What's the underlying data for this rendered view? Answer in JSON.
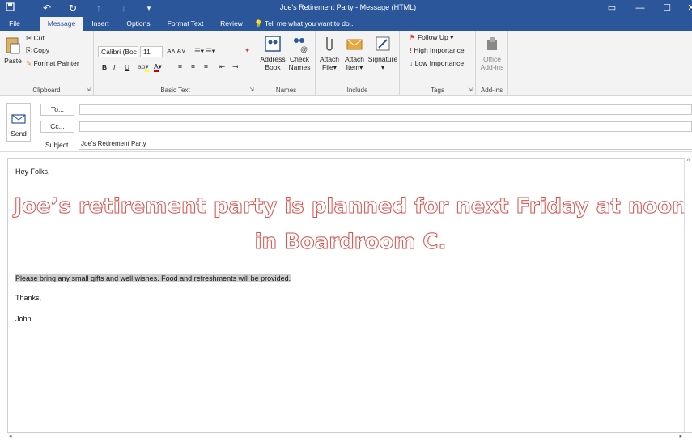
{
  "window": {
    "title": "Joe's Retirement Party - Message (HTML)",
    "save_icon": "save-icon",
    "undo_icon": "undo-icon",
    "redo_icon": "redo-icon",
    "up_icon": "up-arrow-icon",
    "down_icon": "down-arrow-icon",
    "customize_icon": "customize-icon",
    "ribbon_display": "ribbon-display-icon",
    "minimize": "minimize-icon",
    "maximize": "maximize-icon",
    "close": "close-icon"
  },
  "tabs": [
    "File",
    "Message",
    "Insert",
    "Options",
    "Format Text",
    "Review"
  ],
  "tellme": "Tell me what you want to do...",
  "clipboard": {
    "paste": "Paste",
    "cut": "Cut",
    "copy": "Copy",
    "format_painter": "Format Painter",
    "label": "Clipboard"
  },
  "basic_text": {
    "font": "Calibri (Boc",
    "size": "11",
    "bold": "B",
    "italic": "I",
    "underline": "U",
    "label": "Basic Text"
  },
  "names": {
    "address": "Address",
    "address2": "Book",
    "check": "Check",
    "check2": "Names",
    "label": "Names"
  },
  "include": {
    "attach_file": "Attach",
    "attach_file2": "File",
    "attach_item": "Attach",
    "attach_item2": "Item",
    "signature": "Signature",
    "label": "Include"
  },
  "tags": {
    "follow_up": "Follow Up",
    "high": "High Importance",
    "low": "Low Importance",
    "label": "Tags"
  },
  "addins": {
    "office": "Office",
    "office2": "Add-ins",
    "label": "Add-ins"
  },
  "compose": {
    "send": "Send",
    "to": "To...",
    "cc": "Cc...",
    "subject_label": "Subject",
    "subject": "Joe's Retirement Party"
  },
  "message": {
    "greeting": "Hey Folks,",
    "headline1": "Joe’s retirement party is planned for next Friday at noon",
    "headline2": "in Boardroom C.",
    "body": "Please bring any small gifts and well wishes. Food and refreshments will be provided.",
    "thanks": "Thanks,",
    "signoff": "John"
  },
  "colors": {
    "accent": "#2b579a",
    "headline_outline": "#d9534f"
  }
}
